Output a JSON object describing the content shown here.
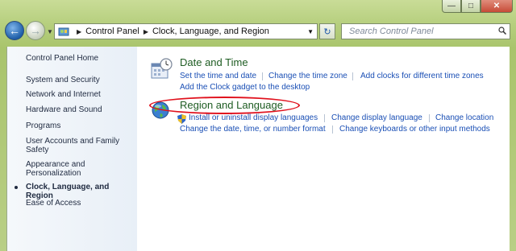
{
  "window": {
    "caption_buttons": [
      "minimize",
      "maximize",
      "close"
    ]
  },
  "toolbar": {
    "breadcrumb": [
      "Control Panel",
      "Clock, Language, and Region"
    ],
    "search_placeholder": "Search Control Panel"
  },
  "sidebar": {
    "home": "Control Panel Home",
    "items": [
      {
        "label": "System and Security"
      },
      {
        "label": "Network and Internet"
      },
      {
        "label": "Hardware and Sound"
      },
      {
        "label": "Programs"
      },
      {
        "label": "User Accounts and Family Safety"
      },
      {
        "label": "Appearance and Personalization"
      },
      {
        "label": "Clock, Language, and Region",
        "current": true
      },
      {
        "label": "Ease of Access"
      }
    ]
  },
  "categories": [
    {
      "title": "Date and Time",
      "links_row1": [
        "Set the time and date",
        "Change the time zone",
        "Add clocks for different time zones"
      ],
      "links_row2": [
        "Add the Clock gadget to the desktop"
      ]
    },
    {
      "title": "Region and Language",
      "links_row1": [
        "Install or uninstall display languages",
        "Change display language",
        "Change location"
      ],
      "links_row2": [
        "Change the date, time, or number format",
        "Change keyboards or other input methods"
      ]
    }
  ],
  "colors": {
    "link": "#1a4fb5",
    "category_title": "#1e5c22",
    "highlight_ellipse": "#e0101c"
  }
}
